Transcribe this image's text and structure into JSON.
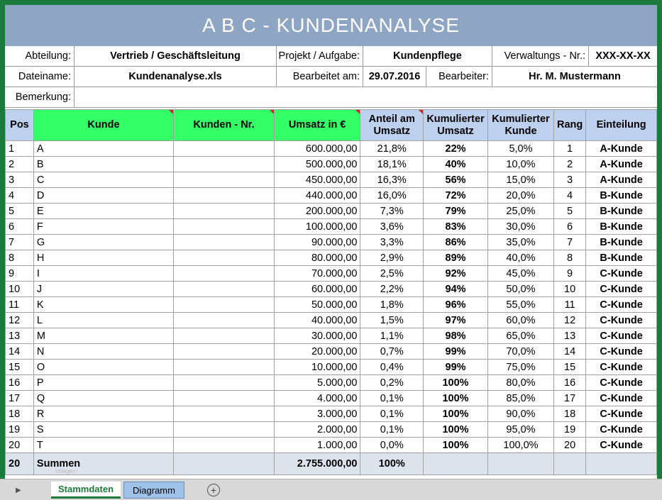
{
  "title": "A B C  -  KUNDENANALYSE",
  "info": {
    "abteilung_label": "Abteilung:",
    "abteilung_value": "Vertrieb / Geschäftsleitung",
    "projekt_label": "Projekt / Aufgabe:",
    "projekt_value": "Kundenpflege",
    "verwaltung_label": "Verwaltungs - Nr.:",
    "verwaltung_value": "XXX-XX-XX",
    "dateiname_label": "Dateiname:",
    "dateiname_value": "Kundenanalyse.xls",
    "bearbeitet_label": "Bearbeitet am:",
    "bearbeitet_value": "29.07.2016",
    "bearbeiter_label": "Bearbeiter:",
    "bearbeiter_value": "Hr. M. Mustermann",
    "bemerkung_label": "Bemerkung:",
    "bemerkung_value": ""
  },
  "headers": {
    "pos": "Pos",
    "kunde": "Kunde",
    "kunden_nr": "Kunden - Nr.",
    "umsatz": "Umsatz in €",
    "anteil": "Anteil am Umsatz",
    "kum_umsatz": "Kumulierter Umsatz",
    "kum_kunde": "Kumulierter Kunde",
    "rang": "Rang",
    "einteilung": "Einteilung"
  },
  "rows": [
    {
      "pos": "1",
      "kunde": "A",
      "nr": "",
      "umsatz": "600.000,00",
      "anteil": "21,8%",
      "kum_umsatz": "22%",
      "kum_kunde": "5,0%",
      "rang": "1",
      "einteilung": "A-Kunde"
    },
    {
      "pos": "2",
      "kunde": "B",
      "nr": "",
      "umsatz": "500.000,00",
      "anteil": "18,1%",
      "kum_umsatz": "40%",
      "kum_kunde": "10,0%",
      "rang": "2",
      "einteilung": "A-Kunde"
    },
    {
      "pos": "3",
      "kunde": "C",
      "nr": "",
      "umsatz": "450.000,00",
      "anteil": "16,3%",
      "kum_umsatz": "56%",
      "kum_kunde": "15,0%",
      "rang": "3",
      "einteilung": "A-Kunde"
    },
    {
      "pos": "4",
      "kunde": "D",
      "nr": "",
      "umsatz": "440.000,00",
      "anteil": "16,0%",
      "kum_umsatz": "72%",
      "kum_kunde": "20,0%",
      "rang": "4",
      "einteilung": "B-Kunde"
    },
    {
      "pos": "5",
      "kunde": "E",
      "nr": "",
      "umsatz": "200.000,00",
      "anteil": "7,3%",
      "kum_umsatz": "79%",
      "kum_kunde": "25,0%",
      "rang": "5",
      "einteilung": "B-Kunde"
    },
    {
      "pos": "6",
      "kunde": "F",
      "nr": "",
      "umsatz": "100.000,00",
      "anteil": "3,6%",
      "kum_umsatz": "83%",
      "kum_kunde": "30,0%",
      "rang": "6",
      "einteilung": "B-Kunde"
    },
    {
      "pos": "7",
      "kunde": "G",
      "nr": "",
      "umsatz": "90.000,00",
      "anteil": "3,3%",
      "kum_umsatz": "86%",
      "kum_kunde": "35,0%",
      "rang": "7",
      "einteilung": "B-Kunde"
    },
    {
      "pos": "8",
      "kunde": "H",
      "nr": "",
      "umsatz": "80.000,00",
      "anteil": "2,9%",
      "kum_umsatz": "89%",
      "kum_kunde": "40,0%",
      "rang": "8",
      "einteilung": "B-Kunde"
    },
    {
      "pos": "9",
      "kunde": "I",
      "nr": "",
      "umsatz": "70.000,00",
      "anteil": "2,5%",
      "kum_umsatz": "92%",
      "kum_kunde": "45,0%",
      "rang": "9",
      "einteilung": "C-Kunde"
    },
    {
      "pos": "10",
      "kunde": "J",
      "nr": "",
      "umsatz": "60.000,00",
      "anteil": "2,2%",
      "kum_umsatz": "94%",
      "kum_kunde": "50,0%",
      "rang": "10",
      "einteilung": "C-Kunde"
    },
    {
      "pos": "11",
      "kunde": "K",
      "nr": "",
      "umsatz": "50.000,00",
      "anteil": "1,8%",
      "kum_umsatz": "96%",
      "kum_kunde": "55,0%",
      "rang": "11",
      "einteilung": "C-Kunde"
    },
    {
      "pos": "12",
      "kunde": "L",
      "nr": "",
      "umsatz": "40.000,00",
      "anteil": "1,5%",
      "kum_umsatz": "97%",
      "kum_kunde": "60,0%",
      "rang": "12",
      "einteilung": "C-Kunde"
    },
    {
      "pos": "13",
      "kunde": "M",
      "nr": "",
      "umsatz": "30.000,00",
      "anteil": "1,1%",
      "kum_umsatz": "98%",
      "kum_kunde": "65,0%",
      "rang": "13",
      "einteilung": "C-Kunde"
    },
    {
      "pos": "14",
      "kunde": "N",
      "nr": "",
      "umsatz": "20.000,00",
      "anteil": "0,7%",
      "kum_umsatz": "99%",
      "kum_kunde": "70,0%",
      "rang": "14",
      "einteilung": "C-Kunde"
    },
    {
      "pos": "15",
      "kunde": "O",
      "nr": "",
      "umsatz": "10.000,00",
      "anteil": "0,4%",
      "kum_umsatz": "99%",
      "kum_kunde": "75,0%",
      "rang": "15",
      "einteilung": "C-Kunde"
    },
    {
      "pos": "16",
      "kunde": "P",
      "nr": "",
      "umsatz": "5.000,00",
      "anteil": "0,2%",
      "kum_umsatz": "100%",
      "kum_kunde": "80,0%",
      "rang": "16",
      "einteilung": "C-Kunde"
    },
    {
      "pos": "17",
      "kunde": "Q",
      "nr": "",
      "umsatz": "4.000,00",
      "anteil": "0,1%",
      "kum_umsatz": "100%",
      "kum_kunde": "85,0%",
      "rang": "17",
      "einteilung": "C-Kunde"
    },
    {
      "pos": "18",
      "kunde": "R",
      "nr": "",
      "umsatz": "3.000,00",
      "anteil": "0,1%",
      "kum_umsatz": "100%",
      "kum_kunde": "90,0%",
      "rang": "18",
      "einteilung": "C-Kunde"
    },
    {
      "pos": "19",
      "kunde": "S",
      "nr": "",
      "umsatz": "2.000,00",
      "anteil": "0,1%",
      "kum_umsatz": "100%",
      "kum_kunde": "95,0%",
      "rang": "19",
      "einteilung": "C-Kunde"
    },
    {
      "pos": "20",
      "kunde": "T",
      "nr": "",
      "umsatz": "1.000,00",
      "anteil": "0,0%",
      "kum_umsatz": "100%",
      "kum_kunde": "100,0%",
      "rang": "20",
      "einteilung": "C-Kunde"
    }
  ],
  "summary": {
    "pos": "20",
    "label": "Summen",
    "ghost_text": "orlagen",
    "umsatz": "2.755.000,00",
    "anteil": "100%"
  },
  "tabs": {
    "active": "Stammdaten",
    "inactive": "Diagramm",
    "add_icon": "plus-circle-icon",
    "nav_icon": "triangle-right-icon"
  },
  "colors": {
    "frame": "#1b7b3c",
    "title_bg": "#8ea5c4",
    "header_blue": "#bdd0ee",
    "header_green": "#33ff66",
    "sum_bg": "#dde3ec"
  }
}
